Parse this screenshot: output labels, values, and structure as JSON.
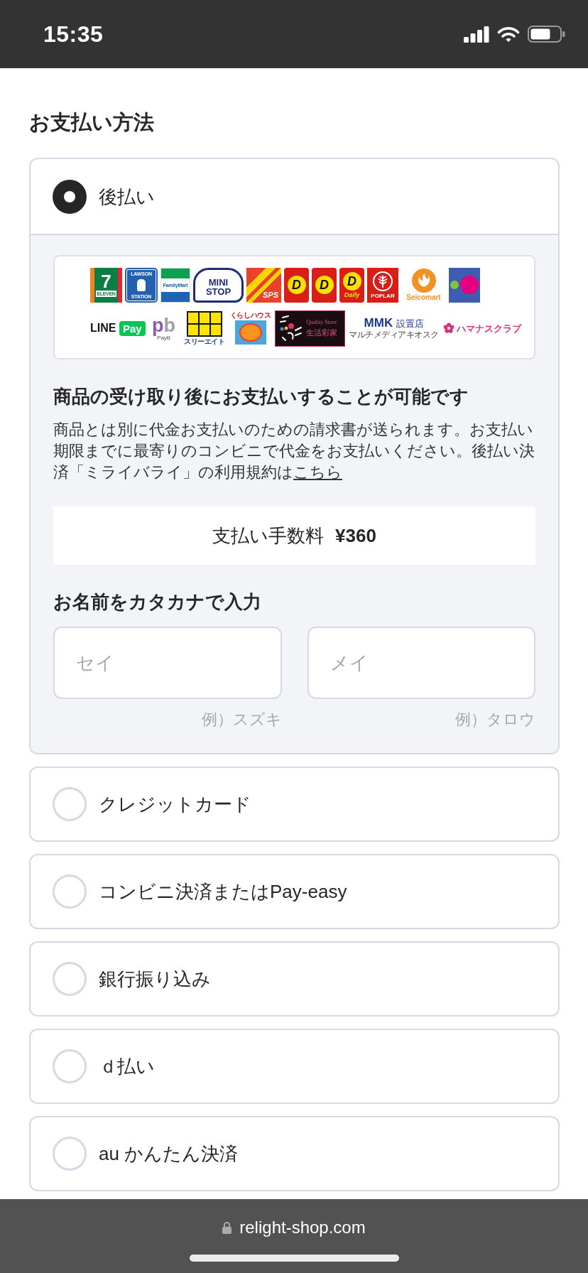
{
  "status_bar": {
    "time": "15:35"
  },
  "section_title": "お支払い方法",
  "payment_options": [
    {
      "label": "後払い",
      "selected": true,
      "details": {
        "logo_rows": [
          {
            "logos": [
              {
                "kind": "stripes",
                "text": [
                  "7",
                  "ELEVEN"
                ]
              },
              {
                "kind": "bottle",
                "text": [
                  "LAWSON",
                  "STATION"
                ]
              },
              {
                "kind": "bands",
                "text": [
                  "FamilyMart"
                ]
              },
              {
                "kind": "house",
                "text": [
                  "MINI",
                  "STOP"
                ]
              },
              {
                "kind": "diagonal",
                "text": [
                  "SPS"
                ]
              },
              {
                "kind": "disc",
                "text": [
                  "D"
                ]
              },
              {
                "kind": "disc",
                "text": [
                  "D"
                ]
              },
              {
                "kind": "disc",
                "text": [
                  "D",
                  "Daily"
                ]
              },
              {
                "kind": "leaf",
                "text": [
                  "POPLAR"
                ]
              },
              {
                "kind": "sunburst",
                "text": [
                  "Seicomart"
                ]
              },
              {
                "kind": "circles"
              }
            ]
          },
          {
            "logos": [
              {
                "kind": "wordpill",
                "text": [
                  "LINE",
                  "Pay"
                ]
              },
              {
                "kind": "letters",
                "text": [
                  "p",
                  "b",
                  "PayB"
                ]
              },
              {
                "kind": "grid",
                "text": [
                  "スリーエイト"
                ]
              },
              {
                "kind": "face",
                "text": [
                  "くらしハウス"
                ]
              },
              {
                "kind": "darktile",
                "text": [
                  "Quality Store",
                  "生活彩家"
                ]
              },
              {
                "kind": "wordstack",
                "text": [
                  "MMK",
                  "設置店",
                  "マルチメディアキオスク"
                ]
              },
              {
                "kind": "flower",
                "text": [
                  "ハマナスクラブ"
                ]
              }
            ]
          }
        ],
        "title": "商品の受け取り後にお支払いすることが可能です",
        "description": "商品とは別に代金お支払いのための請求書が送られます。お支払い期限までに最寄りのコンビニで代金をお支払いください。後払い決済「ミライバライ」の利用規約は",
        "terms_link": "こちら",
        "fee": {
          "label": "支払い手数料",
          "amount": "¥360"
        },
        "name_title": "お名前をカタカナで入力",
        "name_fields": [
          {
            "placeholder": "セイ",
            "hint": "例）スズキ"
          },
          {
            "placeholder": "メイ",
            "hint": "例）タロウ"
          }
        ]
      }
    },
    {
      "label": "クレジットカード",
      "selected": false
    },
    {
      "label": "コンビニ決済またはPay-easy",
      "selected": false
    },
    {
      "label": "銀行振り込み",
      "selected": false
    },
    {
      "label": "ｄ払い",
      "selected": false
    },
    {
      "label": "au かんたん決済",
      "selected": false
    }
  ],
  "browser_bar": {
    "url": "relight-shop.com"
  }
}
